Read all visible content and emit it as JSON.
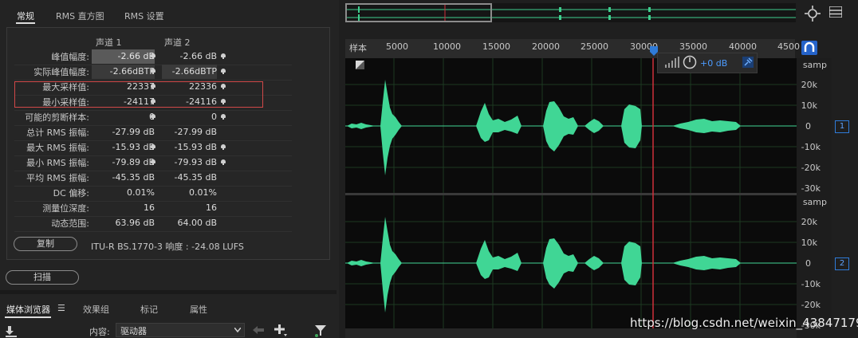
{
  "stats_tabs": [
    "常规",
    "RMS 直方图",
    "RMS 设置"
  ],
  "columns": [
    "声道 1",
    "声道 2"
  ],
  "rows": [
    {
      "label": "峰值幅度:",
      "c1": "-2.66 dB",
      "c2": "-2.66 dB"
    },
    {
      "label": "实际峰值幅度:",
      "c1": "-2.66dBTP",
      "c2": "-2.66dBTP"
    },
    {
      "label": "最大采样值:",
      "c1": "22337",
      "c2": "22336"
    },
    {
      "label": "最小采样值:",
      "c1": "-24117",
      "c2": "-24116"
    },
    {
      "label": "可能的剪断样本:",
      "c1": "0",
      "c2": "0"
    },
    {
      "label": "总计 RMS 振幅:",
      "c1": "-27.99 dB",
      "c2": "-27.99 dB"
    },
    {
      "label": "最大 RMS 振幅:",
      "c1": "-15.93 dB",
      "c2": "-15.93 dB"
    },
    {
      "label": "最小 RMS 振幅:",
      "c1": "-79.89 dB",
      "c2": "-79.93 dB"
    },
    {
      "label": "平均 RMS 振幅:",
      "c1": "-45.35 dB",
      "c2": "-45.35 dB"
    },
    {
      "label": "DC 偏移:",
      "c1": "0.01%",
      "c2": "0.01%"
    },
    {
      "label": "测量位深度:",
      "c1": "16",
      "c2": "16"
    },
    {
      "label": "动态范围:",
      "c1": "63.96 dB",
      "c2": "64.00 dB"
    }
  ],
  "copy_button": "复制",
  "lufs_text": "ITU-R BS.1770-3 响度 : -24.08 LUFS",
  "scan_button": "扫描",
  "bottom_tabs": [
    "媒体浏览器",
    "效果组",
    "标记",
    "属性"
  ],
  "menu_glyph": "☰",
  "content_label": "内容:",
  "content_value": "驱动器",
  "ruler": {
    "unit_label": "样本",
    "ticks": [
      "5000",
      "10000",
      "15000",
      "20000",
      "25000",
      "30000",
      "35000",
      "40000",
      "4500"
    ]
  },
  "y_axis": {
    "unit": "samp",
    "ch1": [
      "20k",
      "10k",
      "0",
      "-10k",
      "-20k",
      "-30k"
    ],
    "ch2": [
      "20k",
      "10k",
      "0",
      "-10k",
      "-20k",
      "-30k"
    ]
  },
  "channel_badges": [
    "1",
    "2"
  ],
  "hud_gain": "+0 dB",
  "watermark": "https://blog.csdn.net/weixin_43847179",
  "colors": {
    "waveform": "#40d695",
    "playhead": "#d0303a",
    "accent": "#2f7bd8"
  }
}
